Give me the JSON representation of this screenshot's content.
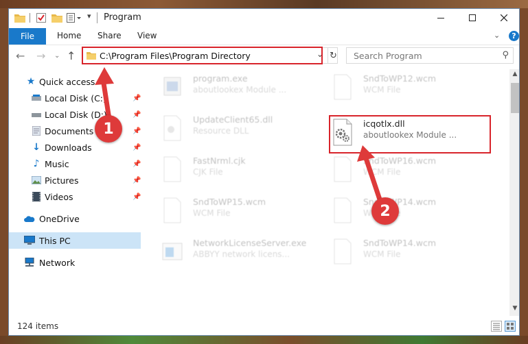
{
  "window": {
    "title": "Program",
    "minimize_icon": "minimize-icon",
    "maximize_icon": "maximize-icon",
    "close_icon": "close-icon"
  },
  "ribbon": {
    "tabs": [
      "File",
      "Home",
      "Share",
      "View"
    ],
    "help_glyph": "?"
  },
  "address": {
    "path": "C:\\Program Files\\Program Directory",
    "search_placeholder": "Search Program"
  },
  "sidebar": {
    "items": [
      {
        "label": "Quick access",
        "icon": "star-icon",
        "pinned": false
      },
      {
        "label": "Local Disk (C:)",
        "icon": "drive-icon",
        "pinned": true
      },
      {
        "label": "Local Disk (D:)",
        "icon": "drive-icon",
        "pinned": true
      },
      {
        "label": "Documents",
        "icon": "documents-icon",
        "pinned": true
      },
      {
        "label": "Downloads",
        "icon": "download-icon",
        "pinned": true
      },
      {
        "label": "Music",
        "icon": "music-icon",
        "pinned": true
      },
      {
        "label": "Pictures",
        "icon": "pictures-icon",
        "pinned": true
      },
      {
        "label": "Videos",
        "icon": "videos-icon",
        "pinned": true
      },
      {
        "label": "OneDrive",
        "icon": "cloud-icon",
        "pinned": false
      },
      {
        "label": "This PC",
        "icon": "computer-icon",
        "pinned": false,
        "selected": true
      },
      {
        "label": "Network",
        "icon": "network-icon",
        "pinned": false
      }
    ]
  },
  "files": [
    {
      "name": "program.exe",
      "type": "aboutlookex Module ...",
      "faded": true
    },
    {
      "name": "SndToWP12.wcm",
      "type": "WCM File",
      "faded": true
    },
    {
      "name": "UpdateClient65.dll",
      "type": "Resource DLL",
      "faded": true
    },
    {
      "name": "icqotlx.dll",
      "type": "aboutlookex Module ...",
      "faded": false
    },
    {
      "name": "FastNrml.cjk",
      "type": "CJK File",
      "faded": true
    },
    {
      "name": "SndToWP16.wcm",
      "type": "WCM File",
      "faded": true
    },
    {
      "name": "SndToWP15.wcm",
      "type": "WCM File",
      "faded": true
    },
    {
      "name": "SndToWP14.wcm",
      "type": "WCM File",
      "faded": true
    },
    {
      "name": "NetworkLicenseServer.exe",
      "type": "ABBYY network licens...",
      "faded": true
    },
    {
      "name": "SndToWP14.wcm",
      "type": "WCM File",
      "faded": true
    }
  ],
  "status": {
    "item_count": "124 items"
  },
  "markers": [
    "1",
    "2"
  ],
  "colors": {
    "accent": "#1979ca",
    "highlight": "#d8232a",
    "marker": "#de3a3a",
    "selected": "#cce4f7"
  }
}
